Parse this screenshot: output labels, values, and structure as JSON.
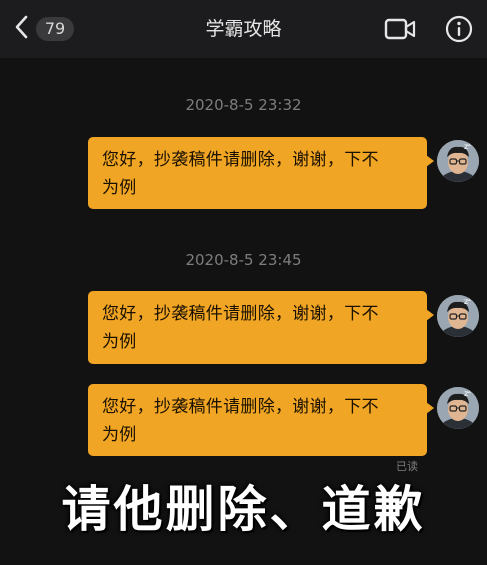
{
  "nav": {
    "back_icon": "chevron-left-icon",
    "unread_count": "79",
    "title": "学霸攻略",
    "video_icon": "video-camera-icon",
    "info_icon": "info-circle-icon"
  },
  "chat": {
    "groups": [
      {
        "timestamp": "2020-8-5 23:32",
        "messages": [
          {
            "line1": "您好，抄袭稿件请删除，谢谢，下不",
            "line2": "为例"
          }
        ]
      },
      {
        "timestamp": "2020-8-5 23:45",
        "messages": [
          {
            "line1": "您好，抄袭稿件请删除，谢谢，下不",
            "line2": "为例"
          },
          {
            "line1": "您好，抄袭稿件请删除，谢谢，下不",
            "line2": "为例"
          }
        ]
      }
    ],
    "read_label": "已读"
  },
  "caption": "请他删除、道歉",
  "colors": {
    "bubble": "#f0a524",
    "background": "#121212",
    "nav_bar": "#1c1c1e",
    "timestamp": "#7d7d7d"
  }
}
